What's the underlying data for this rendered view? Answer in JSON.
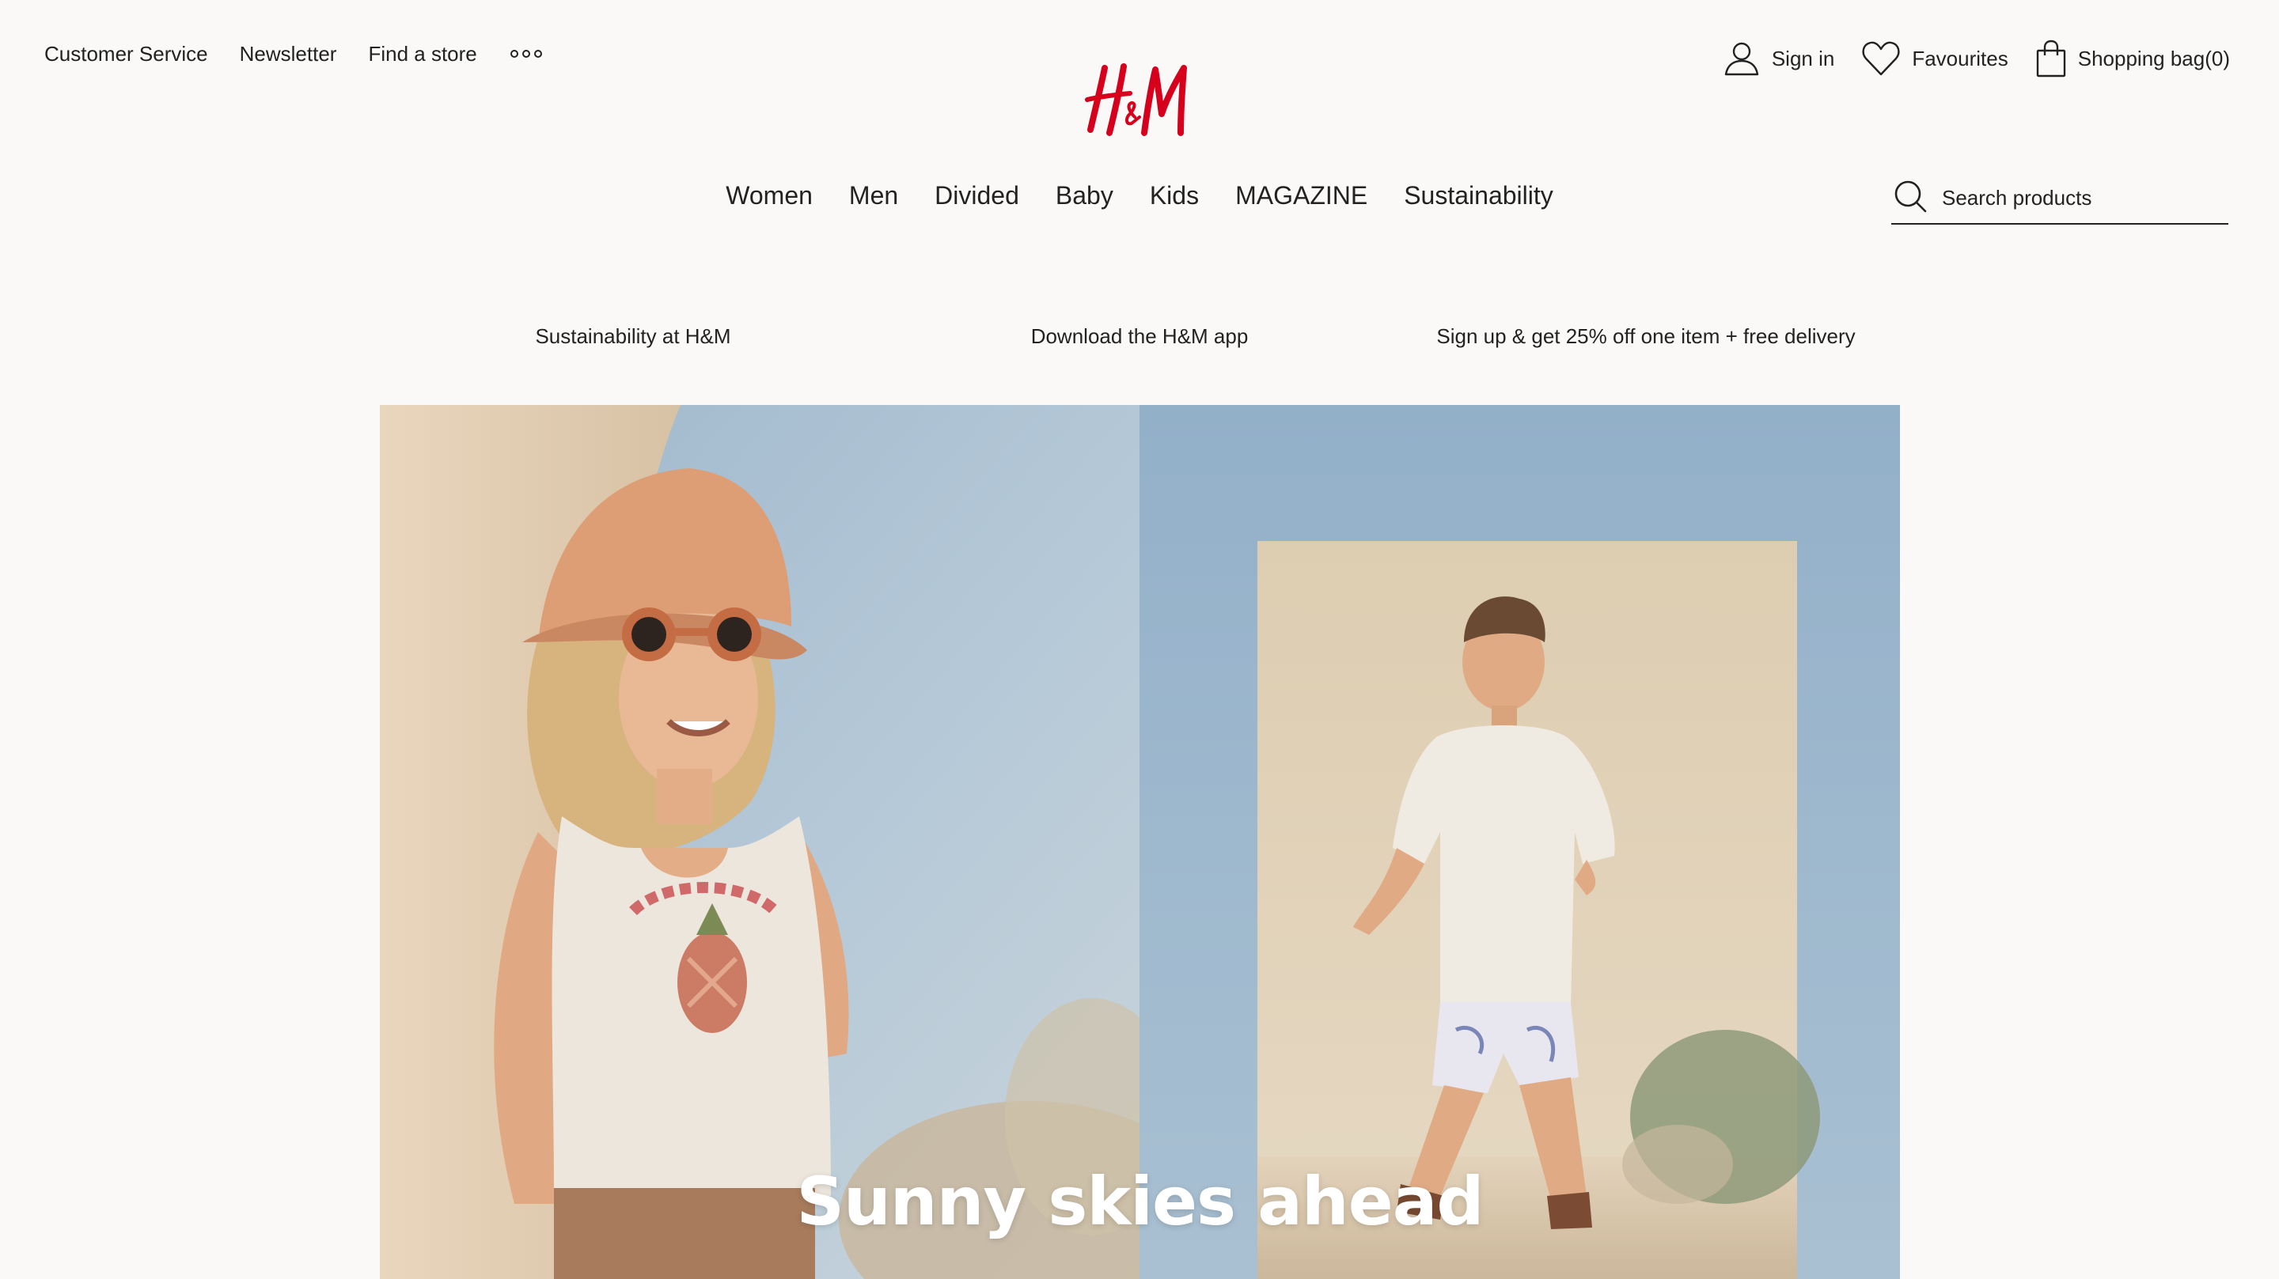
{
  "utility_links": {
    "customer_service": "Customer Service",
    "newsletter": "Newsletter",
    "find_store": "Find a store"
  },
  "brand": {
    "name": "H&M",
    "color": "#d6001c"
  },
  "account": {
    "sign_in": "Sign in",
    "favourites": "Favourites",
    "shopping_bag": "Shopping bag(0)"
  },
  "main_nav": {
    "women": "Women",
    "men": "Men",
    "divided": "Divided",
    "baby": "Baby",
    "kids": "Kids",
    "magazine": "MAGAZINE",
    "sustainability": "Sustainability"
  },
  "search": {
    "placeholder": "Search products"
  },
  "promos": {
    "sustainability": "Sustainability at H&M",
    "app": "Download the H&M app",
    "signup": "Sign up & get 25% off one item + free delivery"
  },
  "hero": {
    "title": "Sunny skies ahead"
  },
  "icons": {
    "more": "more-dots-icon",
    "user": "user-icon",
    "heart": "heart-icon",
    "bag": "shopping-bag-icon",
    "search": "search-icon"
  },
  "colors": {
    "background": "#faf9f8",
    "text": "#222222",
    "sky": "#a8bfd3"
  }
}
